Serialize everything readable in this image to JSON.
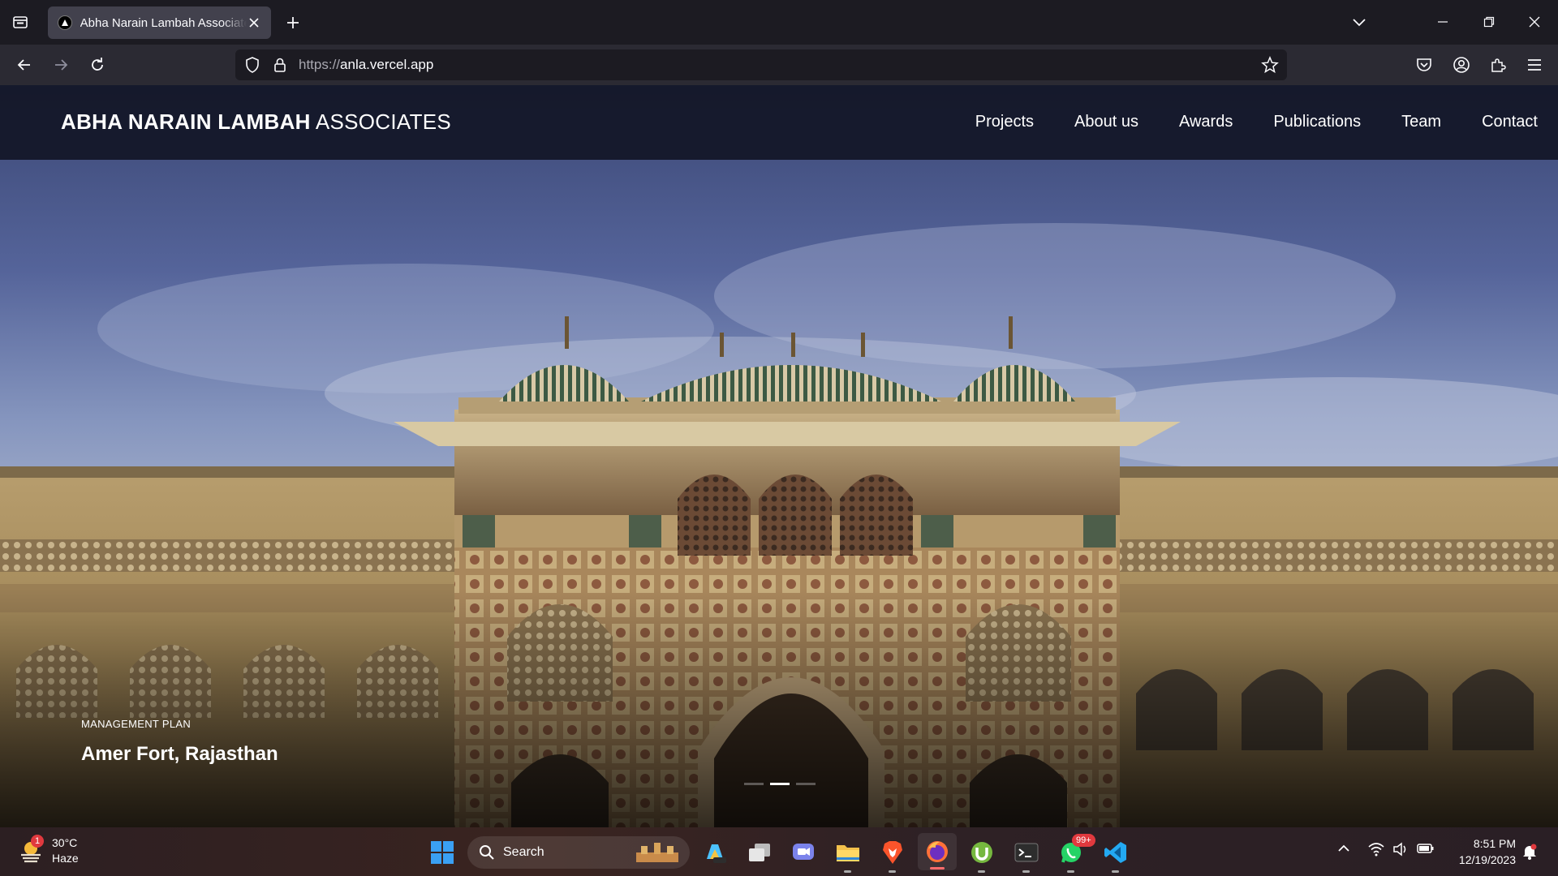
{
  "browser": {
    "tab_title": "Abha Narain Lambah Associates",
    "url_scheme": "https://",
    "url_host": "anla.vercel.app"
  },
  "site": {
    "brand_strong": "ABHA NARAIN LAMBAH",
    "brand_light": "ASSOCIATES",
    "nav": [
      "Projects",
      "About us",
      "Awards",
      "Publications",
      "Team",
      "Contact"
    ]
  },
  "hero": {
    "kicker": "MANAGEMENT PLAN",
    "title": "Amer Fort, Rajasthan",
    "slide_count": 3,
    "active_slide": 2
  },
  "taskbar": {
    "weather_temp": "30°C",
    "weather_desc": "Haze",
    "weather_badge": "1",
    "search_label": "Search",
    "whatsapp_badge": "99+",
    "time": "8:51 PM",
    "date": "12/19/2023"
  },
  "colors": {
    "chrome_dark": "#1c1b22",
    "chrome_toolbar": "#2b2a33",
    "header_bg": "#121626",
    "accent_firefox": "#ff6b6b"
  }
}
